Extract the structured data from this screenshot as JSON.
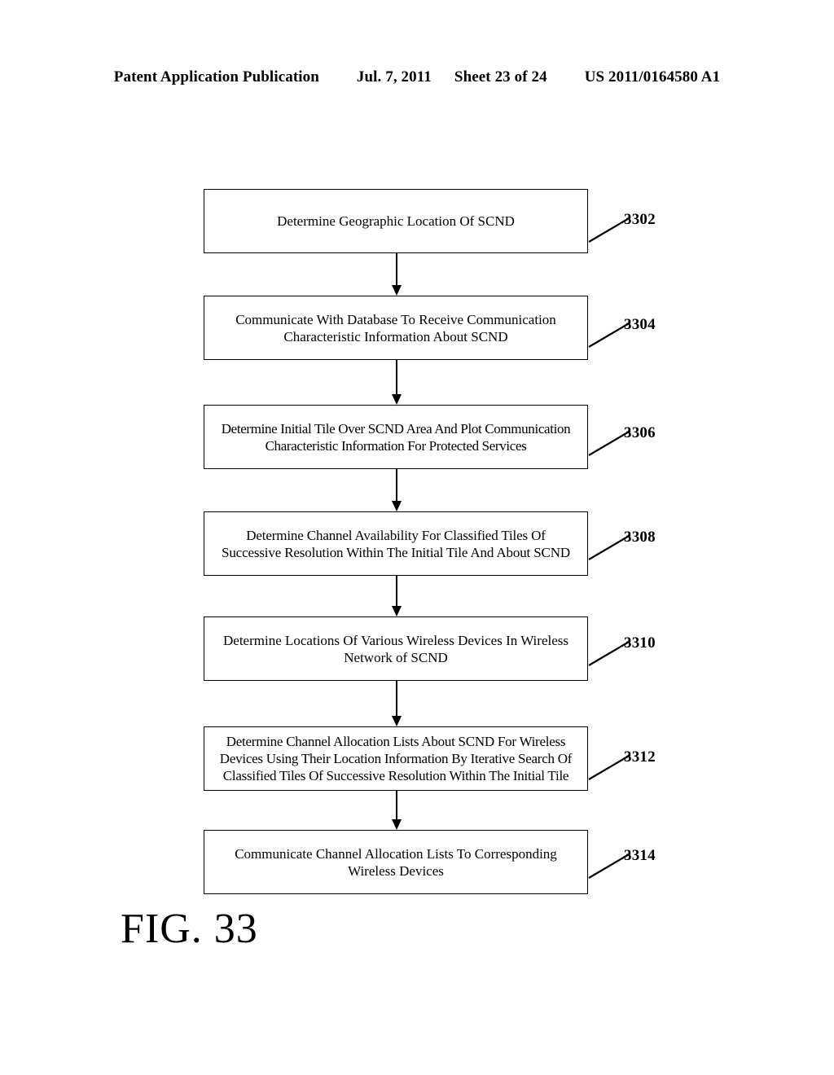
{
  "header": {
    "publication_label": "Patent Application Publication",
    "date": "Jul. 7, 2011",
    "sheet": "Sheet 23 of 24",
    "publication_number": "US 2011/0164580 A1"
  },
  "figure": {
    "caption": "FIG. 33"
  },
  "flowchart": {
    "nodes": [
      {
        "ref": "3302",
        "text": "Determine Geographic Location Of SCND"
      },
      {
        "ref": "3304",
        "text": "Communicate With Database To Receive Communication\nCharacteristic Information About SCND"
      },
      {
        "ref": "3306",
        "text": "Determine Initial Tile Over SCND Area And Plot Communication\nCharacteristic Information For Protected Services"
      },
      {
        "ref": "3308",
        "text": "Determine Channel Availability For Classified Tiles Of\nSuccessive Resolution Within The Initial Tile And About SCND"
      },
      {
        "ref": "3310",
        "text": "Determine Locations Of Various Wireless Devices In Wireless\nNetwork of SCND"
      },
      {
        "ref": "3312",
        "text": "Determine Channel Allocation Lists About SCND For Wireless\nDevices Using Their Location Information By Iterative Search Of\nClassified Tiles Of Successive Resolution Within The Initial Tile"
      },
      {
        "ref": "3314",
        "text": "Communicate Channel Allocation Lists To Corresponding\nWireless Devices"
      }
    ]
  },
  "style": {
    "line_color": "#000000",
    "background_color": "#ffffff"
  }
}
